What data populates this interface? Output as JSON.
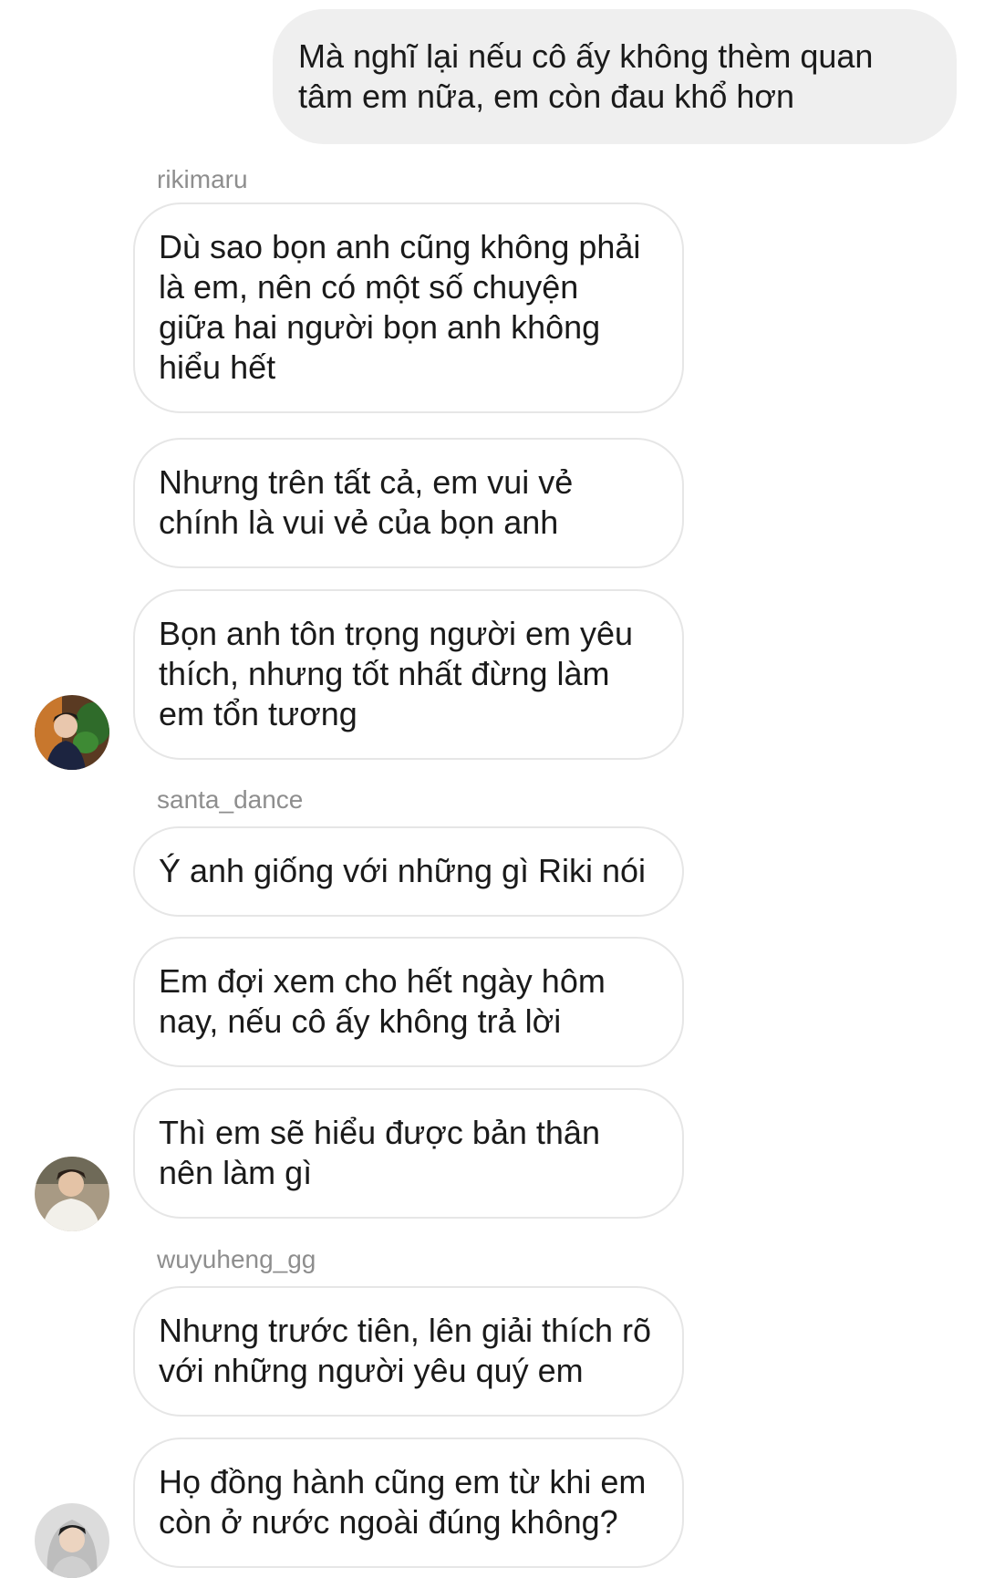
{
  "chat": {
    "outgoing": [
      {
        "text": "Mà nghĩ lại nếu cô ấy không thèm quan\ntâm em nữa, em còn đau khổ hơn"
      }
    ],
    "groups": [
      {
        "sender": "rikimaru",
        "avatar_icon": "user-avatar-photo-plant",
        "messages": [
          "Dù sao bọn anh cũng không phải\nlà em, nên có một số chuyện\ngiữa hai người bọn anh không\nhiểu hết",
          "Nhưng trên tất cả, em vui vẻ\nchính là vui vẻ của bọn anh",
          "Bọn anh tôn trọng người em yêu\nthích, nhưng tốt nhất đừng làm\nem tổn tương"
        ]
      },
      {
        "sender": "santa_dance",
        "avatar_icon": "user-avatar-photo-white-shirt",
        "messages": [
          "Ý anh giống với những gì Riki nói",
          "Em đợi xem cho hết ngày hôm\nnay, nếu cô ấy không trả lời",
          "Thì em sẽ hiểu được bản thân\nnên làm gì"
        ]
      },
      {
        "sender": "wuyuheng_gg",
        "avatar_icon": "user-avatar-photo-hoodie",
        "messages": [
          "Nhưng trước tiên, lên giải thích rõ\nvới những người yêu quý em",
          "Họ đồng hành cũng em từ khi em\ncòn ở nước ngoài đúng không?"
        ]
      }
    ]
  },
  "colors": {
    "outgoing_bubble": "#efefef",
    "incoming_border": "#e6e6e6",
    "username": "#8e8e8e",
    "text": "#1a1a1a"
  }
}
